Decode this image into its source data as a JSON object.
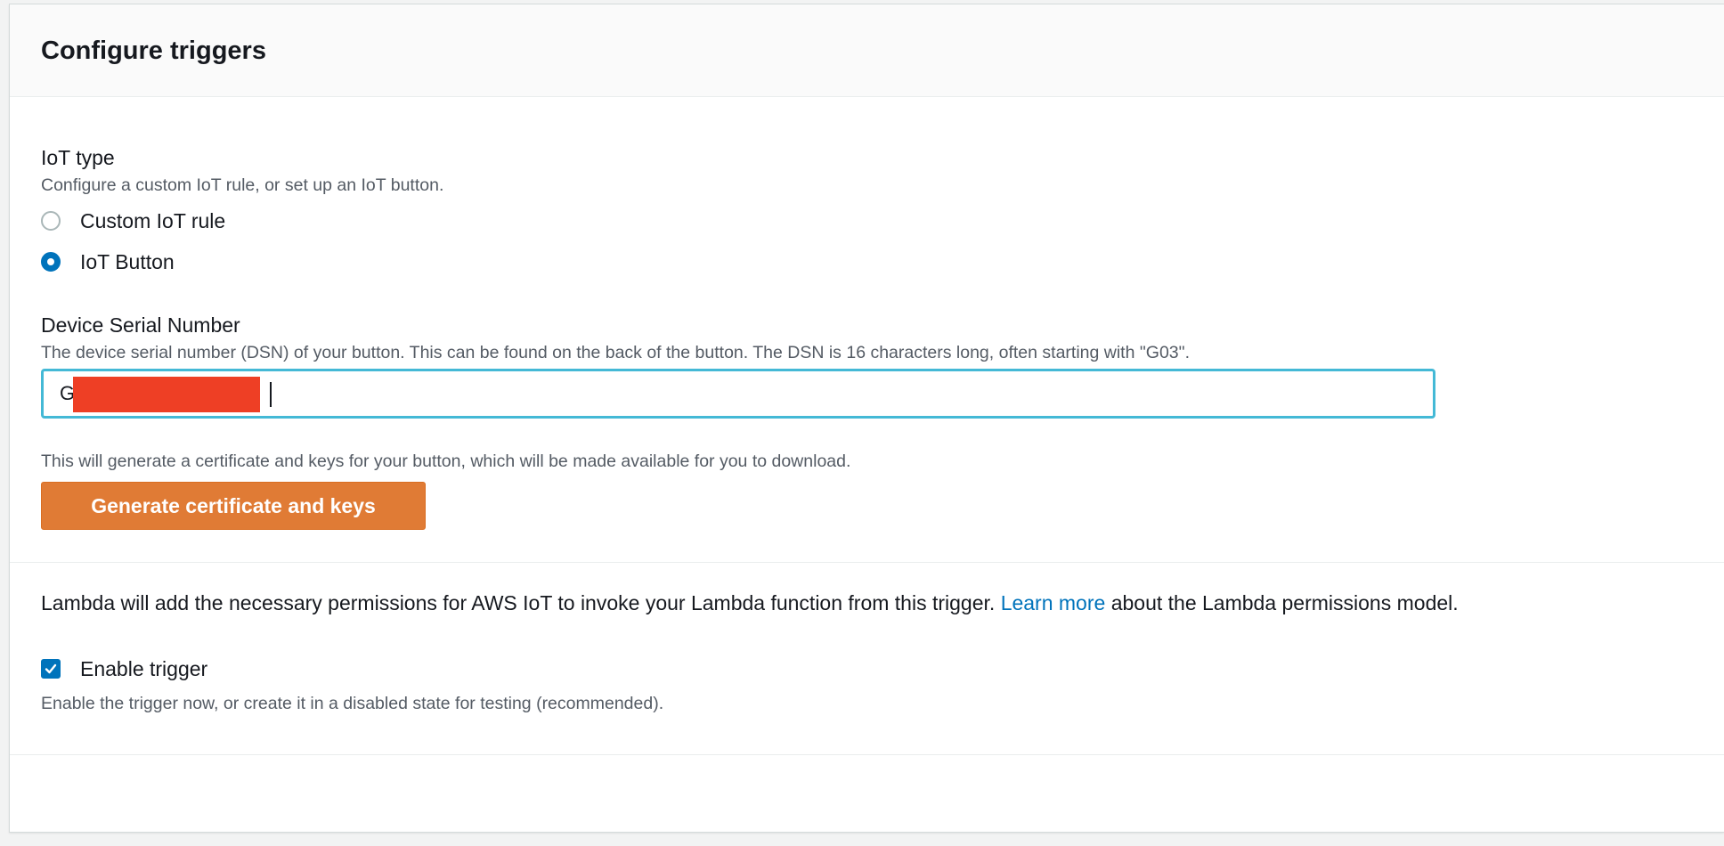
{
  "panel": {
    "title": "Configure triggers"
  },
  "iot_type": {
    "label": "IoT type",
    "description": "Configure a custom IoT rule, or set up an IoT button.",
    "options": [
      {
        "label": "Custom IoT rule",
        "selected": false
      },
      {
        "label": "IoT Button",
        "selected": true
      }
    ]
  },
  "device_serial": {
    "label": "Device Serial Number",
    "description": "The device serial number (DSN) of your button. This can be found on the back of the button. The DSN is 16 characters long, often starting with \"G03\".",
    "value": "G                                3"
  },
  "certificate": {
    "note": "This will generate a certificate and keys for your button, which will be made available for you to download.",
    "button_label": "Generate certificate and keys"
  },
  "permissions": {
    "text_before": "Lambda will add the necessary permissions for AWS IoT to invoke your Lambda function from this trigger. ",
    "link_text": "Learn more",
    "text_after": " about the Lambda permissions model."
  },
  "enable_trigger": {
    "label": "Enable trigger",
    "checked": true,
    "description": "Enable the trigger now, or create it in a disabled state for testing (recommended)."
  },
  "colors": {
    "accent": "#0073bb",
    "primary_button": "#e07b35",
    "focus_border": "#44b9d6",
    "redaction": "#ee3f25"
  }
}
